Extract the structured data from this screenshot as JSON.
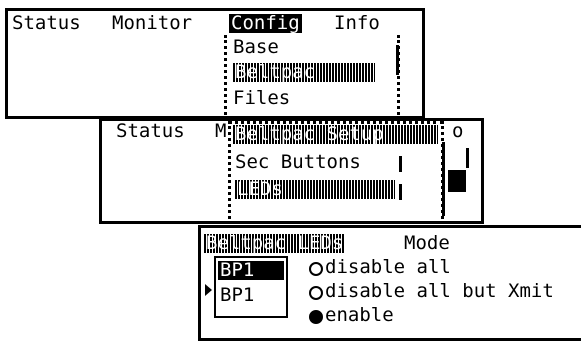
{
  "screen1": {
    "menu": [
      "Status",
      "Monitor",
      "Config",
      "Info"
    ],
    "dropdown": [
      "Base",
      "Beltpac",
      "Files"
    ]
  },
  "screen2": {
    "menu_left": [
      "Status",
      "M"
    ],
    "title": "Beltpac Setup",
    "items": [
      "Sec Buttons",
      "LEDs"
    ],
    "right_letter": "o"
  },
  "screen3": {
    "title": "Beltpac LEDs",
    "mode_label": "Mode",
    "list": [
      "BP1",
      "BP1"
    ],
    "options": [
      {
        "label": "disable all",
        "selected": false
      },
      {
        "label": "disable all but Xmit",
        "selected": false
      },
      {
        "label": "enable",
        "selected": true
      }
    ]
  }
}
